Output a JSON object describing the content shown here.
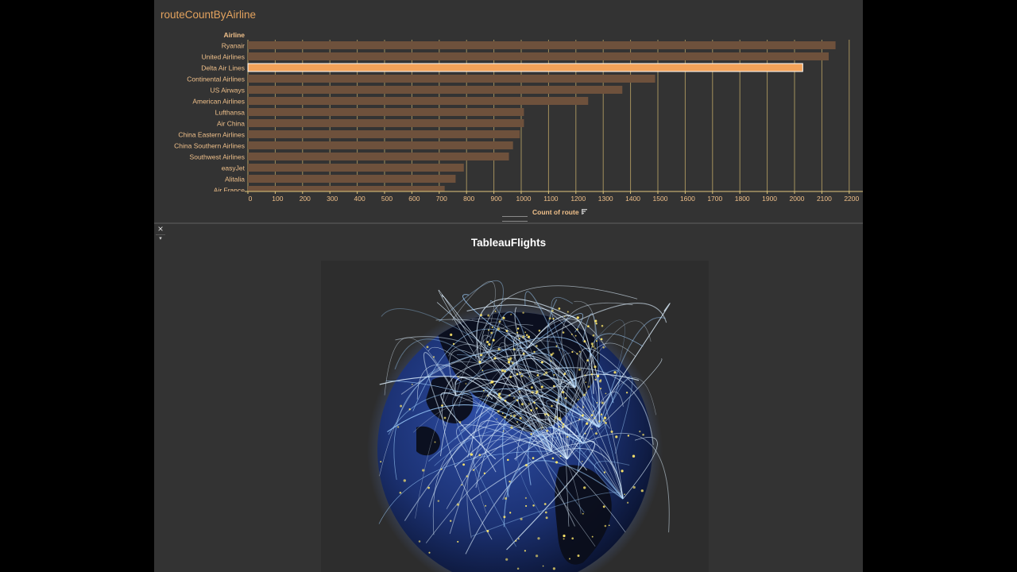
{
  "sheet_title": "routeCountByAirline",
  "chart_data": {
    "type": "bar",
    "orientation": "horizontal",
    "title": "",
    "row_header": "Airline",
    "xlabel": "Count of route",
    "categories": [
      "Ryanair",
      "United Airlines",
      "Delta Air Lines",
      "Continental Airlines",
      "US Airways",
      "American Airlines",
      "Lufthansa",
      "Air China",
      "China Eastern Airlines",
      "China Southern Airlines",
      "Southwest Airlines",
      "easyJet",
      "Alitalia",
      "Air France"
    ],
    "values": [
      2150,
      2125,
      2030,
      1490,
      1370,
      1245,
      1010,
      1010,
      995,
      970,
      955,
      790,
      760,
      720
    ],
    "highlighted": "Delta Air Lines",
    "xlim": [
      0,
      2250
    ],
    "xticks": [
      0,
      100,
      200,
      300,
      400,
      500,
      600,
      700,
      800,
      900,
      1000,
      1100,
      1200,
      1300,
      1400,
      1500,
      1600,
      1700,
      1800,
      1900,
      2000,
      2100,
      2200
    ],
    "grid": true,
    "sorted": "descending",
    "colors": {
      "bar": "#6e513c",
      "highlight": "#f2a259",
      "text": "#f0c08a",
      "grid": "#c9b06a",
      "axis": "#e0c77c"
    }
  },
  "map_title": "TableauFlights",
  "controls": {
    "close": "×",
    "menu": "▾"
  },
  "icons": {
    "sort": "sort-icon"
  }
}
